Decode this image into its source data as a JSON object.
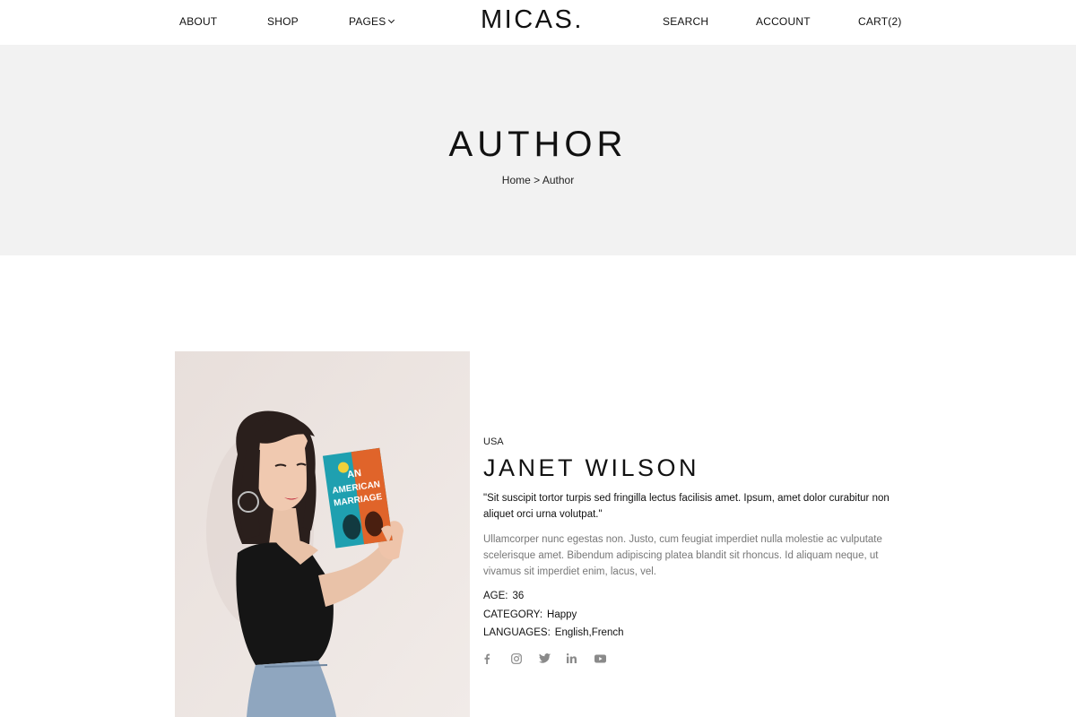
{
  "header": {
    "logo": "MICAS.",
    "nav_left": [
      {
        "label": "ABOUT"
      },
      {
        "label": "SHOP"
      },
      {
        "label": "PAGES"
      }
    ],
    "nav_right": [
      {
        "label": "SEARCH"
      },
      {
        "label": "ACCOUNT"
      },
      {
        "label": "CART(2)"
      }
    ]
  },
  "hero": {
    "title": "AUTHOR",
    "breadcrumb": {
      "home": "Home",
      "separator": ">",
      "current": "Author"
    }
  },
  "author": {
    "country": "USA",
    "name": "JANET WILSON",
    "quote": "\"Sit suscipit tortor turpis sed fringilla lectus facilisis amet. Ipsum, amet dolor curabitur non aliquet orci urna volutpat.\"",
    "description": "Ullamcorper nunc egestas non. Justo, cum feugiat imperdiet nulla molestie ac vulputate scelerisque amet. Bibendum adipiscing platea blandit sit rhoncus. Id aliquam neque, ut vivamus sit imperdiet enim, lacus, vel.",
    "details": [
      {
        "label": "AGE:",
        "value": "36"
      },
      {
        "label": "CATEGORY:",
        "value": "Happy"
      },
      {
        "label": "LANGUAGES:",
        "value": "English,French"
      }
    ],
    "socials": [
      "facebook-icon",
      "instagram-icon",
      "twitter-icon",
      "linkedin-icon",
      "youtube-icon"
    ]
  },
  "photo": {
    "book_title": "AN AMERICAN MARRIAGE"
  },
  "colors": {
    "hero_bg": "#f2f2f2",
    "muted_text": "#777777",
    "icon_gray": "#8a8a8a"
  }
}
